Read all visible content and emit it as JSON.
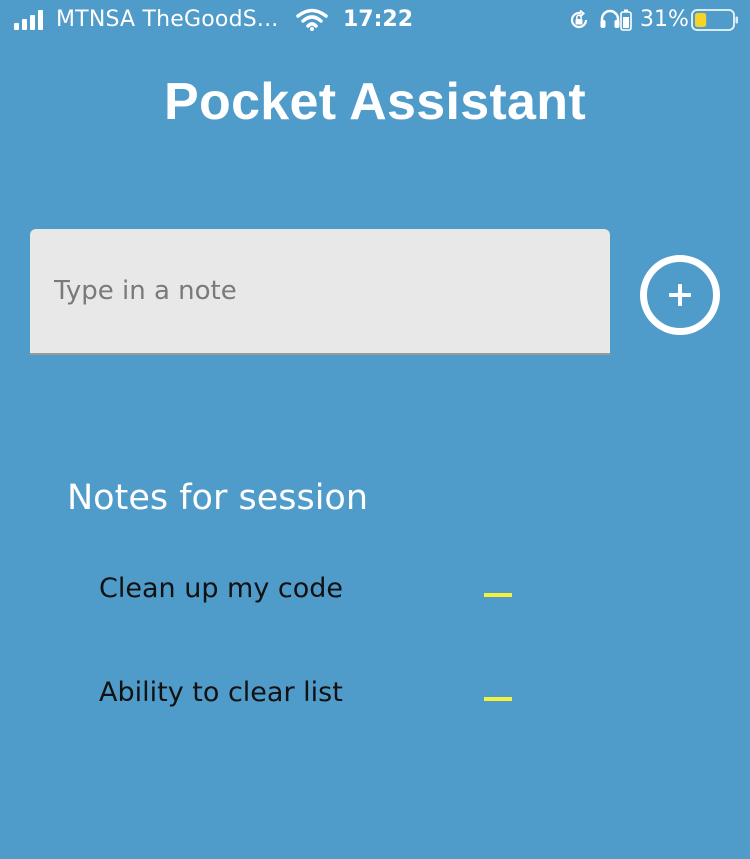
{
  "status_bar": {
    "carrier": "MTNSA TheGoodS...",
    "time": "17:22",
    "battery_percent": "31%",
    "battery_level": 0.31,
    "battery_color": "#f5d327",
    "icons": [
      "signal-icon",
      "wifi-icon",
      "rotation-lock-icon",
      "headphones-icon",
      "battery-icon"
    ]
  },
  "app": {
    "title": "Pocket Assistant"
  },
  "note_input": {
    "placeholder": "Type in a note",
    "value": ""
  },
  "add_button": {
    "icon": "plus-icon"
  },
  "notes": {
    "heading": "Notes for session",
    "items": [
      {
        "text": "Clean up my code",
        "remove_icon": "minus-icon"
      },
      {
        "text": "Ability to clear list",
        "remove_icon": "minus-icon"
      }
    ]
  },
  "colors": {
    "background": "#4f9bc9",
    "input_background": "#e8e8e8",
    "remove_accent": "#f3f03e",
    "text_light": "#ffffff",
    "text_dark": "#111111"
  }
}
